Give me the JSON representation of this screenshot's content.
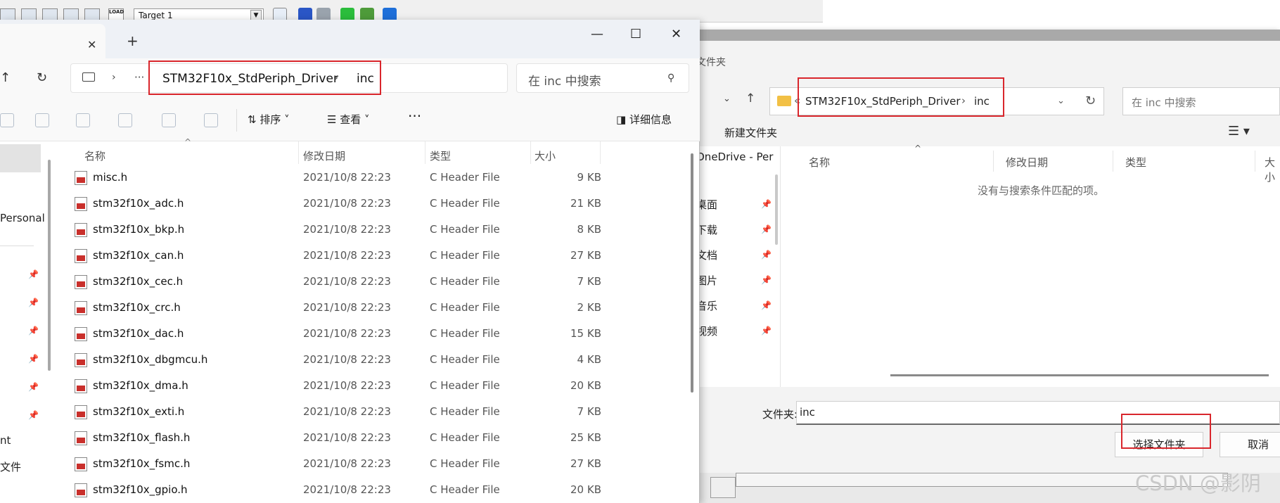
{
  "ide": {
    "target_label": "Target 1",
    "load_label": "LOAD"
  },
  "dialog": {
    "title": "文件夹",
    "address": {
      "lead": "«",
      "seg1": "STM32F10x_StdPeriph_Driver",
      "sep": "›",
      "seg2": "inc"
    },
    "search_placeholder": "在 inc 中搜索",
    "new_folder": "新建文件夹",
    "nav_items": [
      {
        "label": "OneDrive - Per",
        "pinned": false
      },
      {
        "label": "桌面",
        "pinned": true
      },
      {
        "label": "下载",
        "pinned": true
      },
      {
        "label": "文档",
        "pinned": true
      },
      {
        "label": "图片",
        "pinned": true
      },
      {
        "label": "音乐",
        "pinned": true
      },
      {
        "label": "视频",
        "pinned": true
      }
    ],
    "columns": {
      "name": "名称",
      "date": "修改日期",
      "type": "类型",
      "size": "大小"
    },
    "empty_message": "没有与搜索条件匹配的项。",
    "filename_label": "文件夹:",
    "filename_value": "inc",
    "select_button": "选择文件夹",
    "cancel_button": "取消"
  },
  "explorer": {
    "address": {
      "ellipsis": "···",
      "seg1": "STM32F10x_StdPeriph_Driver",
      "sep": "›",
      "seg2": "inc"
    },
    "search_placeholder": "在 inc 中搜索",
    "cmd": {
      "sort": "排序",
      "view": "查看",
      "more": "···",
      "details": "详细信息"
    },
    "nav_items": [
      {
        "label": "Personal"
      },
      {
        "label": "nt"
      },
      {
        "label": "文件"
      }
    ],
    "columns": {
      "name": "名称",
      "date": "修改日期",
      "type": "类型",
      "size": "大小"
    },
    "files": [
      {
        "name": "misc.h",
        "date": "2021/10/8 22:23",
        "type": "C Header File",
        "size": "9 KB"
      },
      {
        "name": "stm32f10x_adc.h",
        "date": "2021/10/8 22:23",
        "type": "C Header File",
        "size": "21 KB"
      },
      {
        "name": "stm32f10x_bkp.h",
        "date": "2021/10/8 22:23",
        "type": "C Header File",
        "size": "8 KB"
      },
      {
        "name": "stm32f10x_can.h",
        "date": "2021/10/8 22:23",
        "type": "C Header File",
        "size": "27 KB"
      },
      {
        "name": "stm32f10x_cec.h",
        "date": "2021/10/8 22:23",
        "type": "C Header File",
        "size": "7 KB"
      },
      {
        "name": "stm32f10x_crc.h",
        "date": "2021/10/8 22:23",
        "type": "C Header File",
        "size": "2 KB"
      },
      {
        "name": "stm32f10x_dac.h",
        "date": "2021/10/8 22:23",
        "type": "C Header File",
        "size": "15 KB"
      },
      {
        "name": "stm32f10x_dbgmcu.h",
        "date": "2021/10/8 22:23",
        "type": "C Header File",
        "size": "4 KB"
      },
      {
        "name": "stm32f10x_dma.h",
        "date": "2021/10/8 22:23",
        "type": "C Header File",
        "size": "20 KB"
      },
      {
        "name": "stm32f10x_exti.h",
        "date": "2021/10/8 22:23",
        "type": "C Header File",
        "size": "7 KB"
      },
      {
        "name": "stm32f10x_flash.h",
        "date": "2021/10/8 22:23",
        "type": "C Header File",
        "size": "25 KB"
      },
      {
        "name": "stm32f10x_fsmc.h",
        "date": "2021/10/8 22:23",
        "type": "C Header File",
        "size": "27 KB"
      },
      {
        "name": "stm32f10x_gpio.h",
        "date": "2021/10/8 22:23",
        "type": "C Header File",
        "size": "20 KB"
      }
    ]
  },
  "watermark": "CSDN @影阴",
  "colors": {
    "highlight": "#d9262c",
    "folder": "#f2c045",
    "header_file": "#c9302c"
  }
}
